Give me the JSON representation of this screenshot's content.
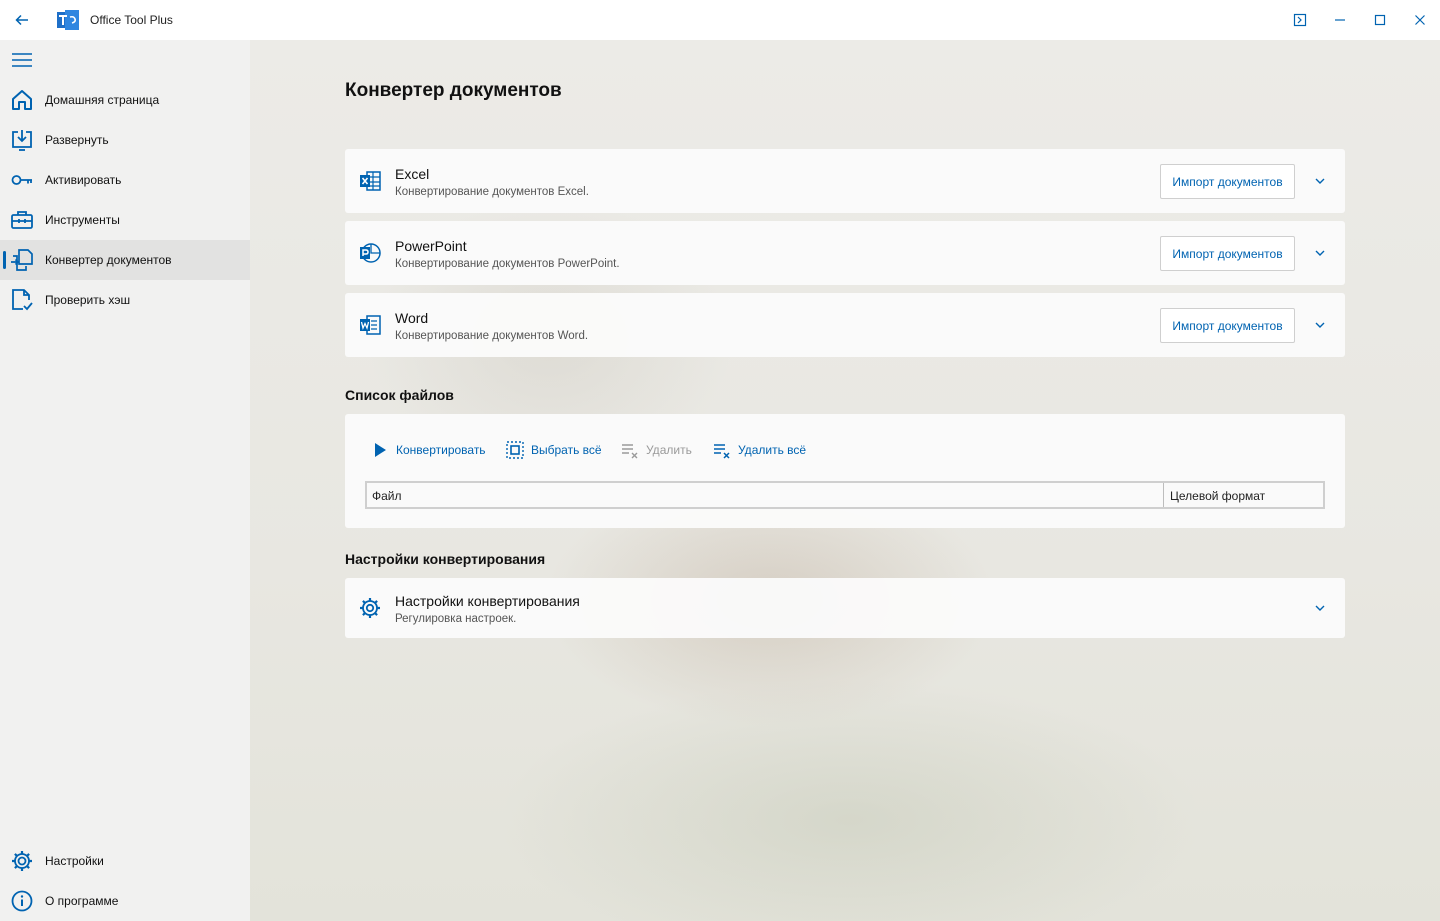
{
  "window": {
    "title": "Office Tool Plus",
    "controls": [
      "compact-overlay-icon",
      "minimize-icon",
      "maximize-icon",
      "close-icon"
    ]
  },
  "sidebar": {
    "items": [
      {
        "label": "Домашняя страница",
        "icon": "home-icon"
      },
      {
        "label": "Развернуть",
        "icon": "deploy-icon"
      },
      {
        "label": "Активировать",
        "icon": "key-icon"
      },
      {
        "label": "Инструменты",
        "icon": "toolbox-icon"
      },
      {
        "label": "Конвертер документов",
        "icon": "convert-icon",
        "active": true
      },
      {
        "label": "Проверить хэш",
        "icon": "file-check-icon"
      }
    ],
    "footer_items": [
      {
        "label": "Настройки",
        "icon": "gear-icon"
      },
      {
        "label": "О программе",
        "icon": "info-icon"
      }
    ]
  },
  "main": {
    "page_title": "Конвертер документов",
    "converters": [
      {
        "title": "Excel",
        "subtitle": "Конвертирование документов Excel.",
        "button": "Импорт документов",
        "icon": "excel-icon"
      },
      {
        "title": "PowerPoint",
        "subtitle": "Конвертирование документов PowerPoint.",
        "button": "Импорт документов",
        "icon": "powerpoint-icon"
      },
      {
        "title": "Word",
        "subtitle": "Конвертирование документов Word.",
        "button": "Импорт документов",
        "icon": "word-icon"
      }
    ],
    "file_list": {
      "section_title": "Список файлов",
      "toolbar": {
        "convert": "Конвертировать",
        "select_all": "Выбрать всё",
        "delete": "Удалить",
        "delete_all": "Удалить всё"
      },
      "columns": {
        "file": "Файл",
        "target_format": "Целевой формат"
      }
    },
    "settings": {
      "section_title": "Настройки конвертирования",
      "card_title": "Настройки конвертирования",
      "card_subtitle": "Регулировка настроек."
    }
  },
  "colors": {
    "accent": "#0063b1",
    "sidebar_bg": "#f1f1f0",
    "active_item_bg": "#e2e2e1"
  }
}
